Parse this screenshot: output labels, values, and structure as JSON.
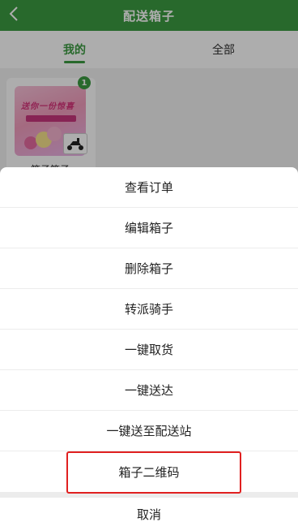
{
  "header": {
    "title": "配送箱子",
    "back_icon": "chevron-left-icon"
  },
  "tabs": [
    {
      "label": "我的",
      "active": true
    },
    {
      "label": "全部",
      "active": false
    }
  ],
  "box_card": {
    "badge": "1",
    "banner_text": "送你一份惊喜",
    "name": "箱子箱子",
    "scooter_icon": "scooter-icon"
  },
  "action_sheet": {
    "items": [
      "查看订单",
      "编辑箱子",
      "删除箱子",
      "转派骑手",
      "一键取货",
      "一键送达",
      "一键送至配送站",
      "箱子二维码"
    ],
    "cancel_label": "取消"
  },
  "colors": {
    "brand": "#3b9b41",
    "highlight": "#e02020"
  }
}
